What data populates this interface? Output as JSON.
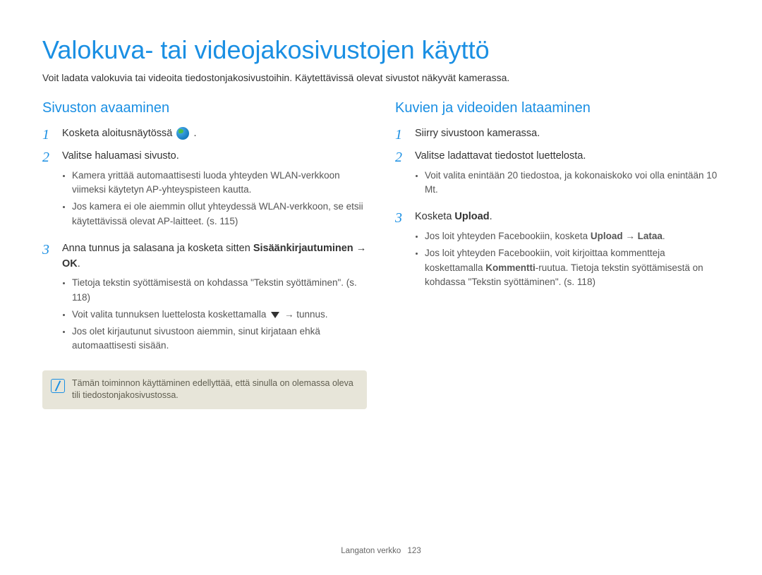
{
  "title": "Valokuva- tai videojakosivustojen käyttö",
  "intro": "Voit ladata valokuvia tai videoita tiedostonjakosivustoihin. Käytettävissä olevat sivustot näkyvät kamerassa.",
  "left": {
    "heading": "Sivuston avaaminen",
    "step1_pre": "Kosketa aloitusnäytössä ",
    "step1_post": ".",
    "step2": "Valitse haluamasi sivusto.",
    "step2_bullets": [
      "Kamera yrittää automaattisesti luoda yhteyden WLAN-verkkoon viimeksi käytetyn AP-yhteyspisteen kautta.",
      "Jos kamera ei ole aiemmin ollut yhteydessä WLAN-verkkoon, se etsii käytettävissä olevat AP-laitteet. (s. 115)"
    ],
    "step3_a": "Anna tunnus ja salasana ja kosketa sitten ",
    "step3_b": "Sisäänkirjautuminen → OK",
    "step3_c": ".",
    "step3_bullets_0": "Tietoja tekstin syöttämisestä on kohdassa \"Tekstin syöttäminen\". (s. 118)",
    "step3_bullets_1_pre": "Voit valita tunnuksen luettelosta koskettamalla ",
    "step3_bullets_1_post": " → tunnus.",
    "step3_bullets_2": "Jos olet kirjautunut sivustoon aiemmin, sinut kirjataan ehkä automaattisesti sisään.",
    "note": "Tämän toiminnon käyttäminen edellyttää, että sinulla on olemassa oleva tili tiedostonjakosivustossa."
  },
  "right": {
    "heading": "Kuvien ja videoiden lataaminen",
    "step1": "Siirry sivustoon kamerassa.",
    "step2": "Valitse ladattavat tiedostot luettelosta.",
    "step2_bullets": [
      "Voit valita enintään 20 tiedostoa, ja kokonaiskoko voi olla enintään 10 Mt."
    ],
    "step3_a": "Kosketa ",
    "step3_b": "Upload",
    "step3_c": ".",
    "step3_bullets_0_pre": "Jos loit yhteyden Facebookiin, kosketa ",
    "step3_bullets_0_bold": "Upload → Lataa",
    "step3_bullets_0_post": ".",
    "step3_bullets_1_pre": "Jos loit yhteyden Facebookiin, voit kirjoittaa kommentteja koskettamalla ",
    "step3_bullets_1_bold": "Kommentti",
    "step3_bullets_1_post": "-ruutua. Tietoja tekstin syöttämisestä on kohdassa \"Tekstin syöttäminen\". (s. 118)"
  },
  "footer_label": "Langaton verkko",
  "footer_page": "123"
}
